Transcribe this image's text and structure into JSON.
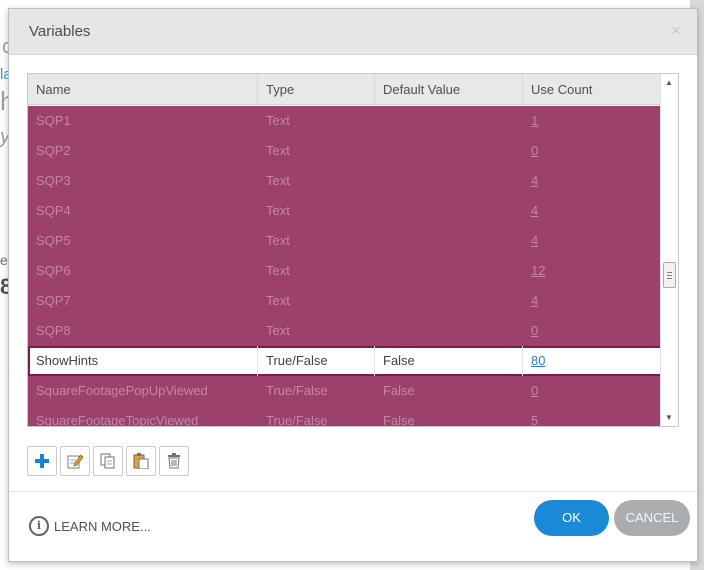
{
  "dialog": {
    "title": "Variables",
    "close_glyph": "×"
  },
  "background": {
    "fragments": [
      "c",
      "la",
      "h",
      "y",
      "e",
      "8"
    ]
  },
  "grid": {
    "columns": [
      "Name",
      "Type",
      "Default Value",
      "Use Count"
    ],
    "rows": [
      {
        "name": "SQP1",
        "type": "Text",
        "default": "",
        "use_count": "1"
      },
      {
        "name": "SQP2",
        "type": "Text",
        "default": "",
        "use_count": "0"
      },
      {
        "name": "SQP3",
        "type": "Text",
        "default": "",
        "use_count": "4"
      },
      {
        "name": "SQP4",
        "type": "Text",
        "default": "",
        "use_count": "4"
      },
      {
        "name": "SQP5",
        "type": "Text",
        "default": "",
        "use_count": "4"
      },
      {
        "name": "SQP6",
        "type": "Text",
        "default": "",
        "use_count": "12"
      },
      {
        "name": "SQP7",
        "type": "Text",
        "default": "",
        "use_count": "4"
      },
      {
        "name": "SQP8",
        "type": "Text",
        "default": "",
        "use_count": "0"
      },
      {
        "name": "ShowHints",
        "type": "True/False",
        "default": "False",
        "use_count": "80",
        "selected": true
      },
      {
        "name": "SquareFootagePopUpViewed",
        "type": "True/False",
        "default": "False",
        "use_count": "0"
      },
      {
        "name": "SquareFootageTopicViewed",
        "type": "True/False",
        "default": "False",
        "use_count": "5"
      }
    ],
    "row_bg_color": "#9b416c",
    "selected_border_color": "#7b1a4b"
  },
  "toolbar": {
    "buttons": [
      {
        "icon": "add-icon"
      },
      {
        "icon": "edit-icon"
      },
      {
        "icon": "copy-icon"
      },
      {
        "icon": "paste-icon"
      },
      {
        "icon": "delete-icon"
      }
    ]
  },
  "footer": {
    "info_glyph": "i",
    "learn_more": "LEARN MORE...",
    "ok_label": "OK",
    "cancel_label": "CANCEL",
    "ok_color": "#1a8ad6",
    "cancel_color": "#a9adb0"
  }
}
